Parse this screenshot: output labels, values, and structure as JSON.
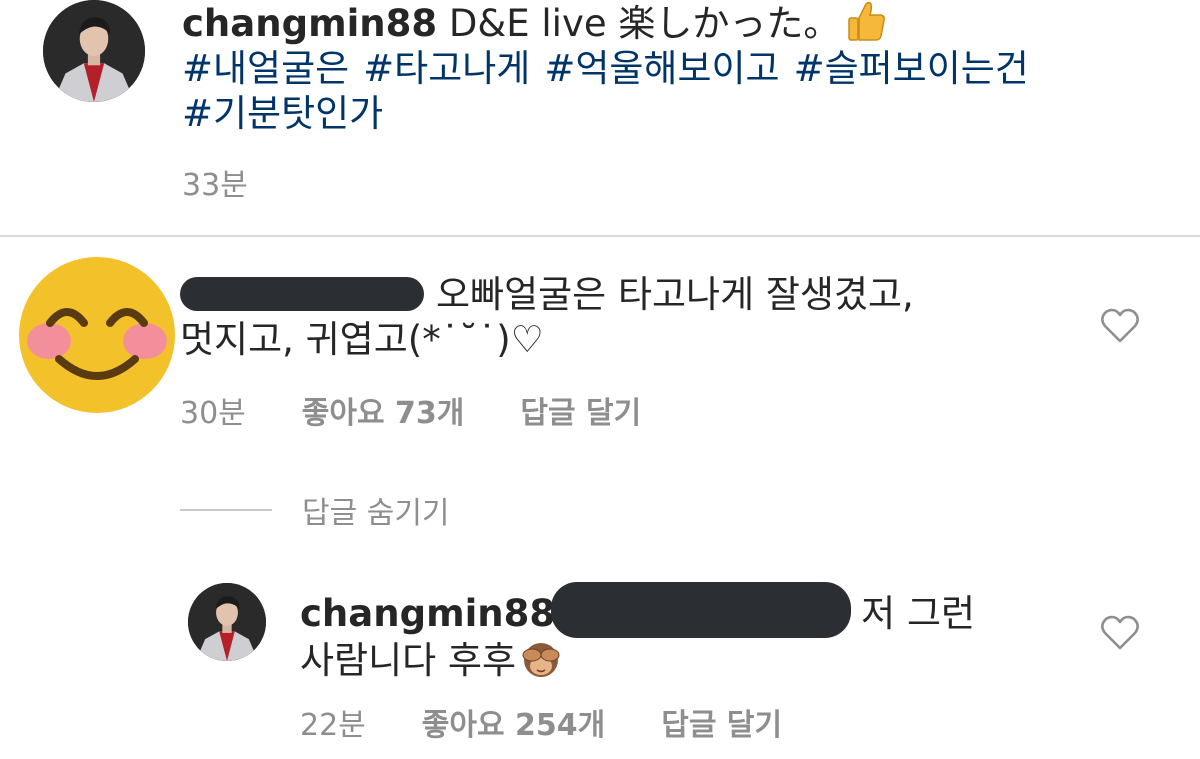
{
  "caption": {
    "username": "changmin88",
    "text": "D&E live 楽しかった。",
    "emoji": "thumbs-up-icon",
    "hashtags": [
      "#내얼굴은",
      "#타고나게",
      "#억울해보이고",
      "#슬퍼보이는건",
      "#기분탓인가"
    ],
    "time": "33분"
  },
  "comment": {
    "text_line1": "오빠얼굴은 타고나게 잘생겼고,",
    "text_line2": "멋지고, 귀엽고(*˙˘˙)♡",
    "time": "30분",
    "likes": "좋아요 73개",
    "reply_action": "답글 달기",
    "avatar": "smiling-face-emoji",
    "like_icon": "heart-outline-icon"
  },
  "replies_toggle": "답글 숨기기",
  "reply": {
    "username": "changmin88",
    "text_line1": "저 그런",
    "text_line2": "사람니다 후후",
    "emoji": "see-no-evil-monkey-icon",
    "time": "22분",
    "likes": "좋아요 254개",
    "reply_action": "답글 달기",
    "like_icon": "heart-outline-icon"
  },
  "colors": {
    "hashtag": "#003569",
    "muted": "#8e8e8e",
    "redaction": "#2b2f33",
    "emoji_yellow": "#f3c12a"
  }
}
